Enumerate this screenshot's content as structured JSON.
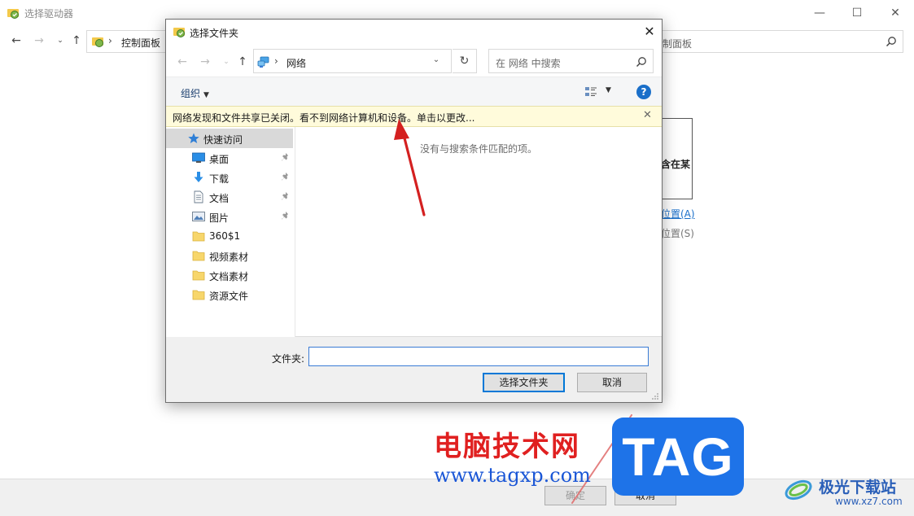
{
  "background_window": {
    "title": "选择驱动器",
    "address_path": "控制面板",
    "search_placeholder": "制面板",
    "panel_text": "含在某",
    "link_a": "位置(A)",
    "link_s": "位置(S)",
    "ok_label": "确定",
    "cancel_label": "取消"
  },
  "dialog": {
    "title": "选择文件夹",
    "address_path": "网络",
    "search_placeholder": "在 网络 中搜索",
    "organize_label": "组织",
    "infobar_text": "网络发现和文件共享已关闭。看不到网络计算机和设备。单击以更改...",
    "empty_message": "没有与搜索条件匹配的项。",
    "nav_items": [
      {
        "label": "快速访问",
        "icon": "star-icon"
      },
      {
        "label": "桌面",
        "icon": "desktop-icon",
        "pinned": true
      },
      {
        "label": "下载",
        "icon": "download-icon",
        "pinned": true
      },
      {
        "label": "文档",
        "icon": "document-icon",
        "pinned": true
      },
      {
        "label": "图片",
        "icon": "picture-icon",
        "pinned": true
      },
      {
        "label": "360$1",
        "icon": "folder-icon"
      },
      {
        "label": "视频素材",
        "icon": "folder-icon"
      },
      {
        "label": "文档素材",
        "icon": "folder-icon"
      },
      {
        "label": "资源文件",
        "icon": "folder-icon"
      }
    ],
    "folder_label": "文件夹:",
    "folder_value": "",
    "select_button": "选择文件夹",
    "cancel_button": "取消"
  },
  "watermark": {
    "site_cn": "电脑技术网",
    "site_url": "www.tagxp.com",
    "tag": "TAG",
    "brand": "极光下载站",
    "brand_url": "www.xz7.com"
  },
  "colors": {
    "accent": "#0078d7",
    "infobar_bg": "#fffbdb",
    "arrow": "#d42020",
    "watermark_red": "#e02020",
    "watermark_blue": "#1e73e8"
  }
}
